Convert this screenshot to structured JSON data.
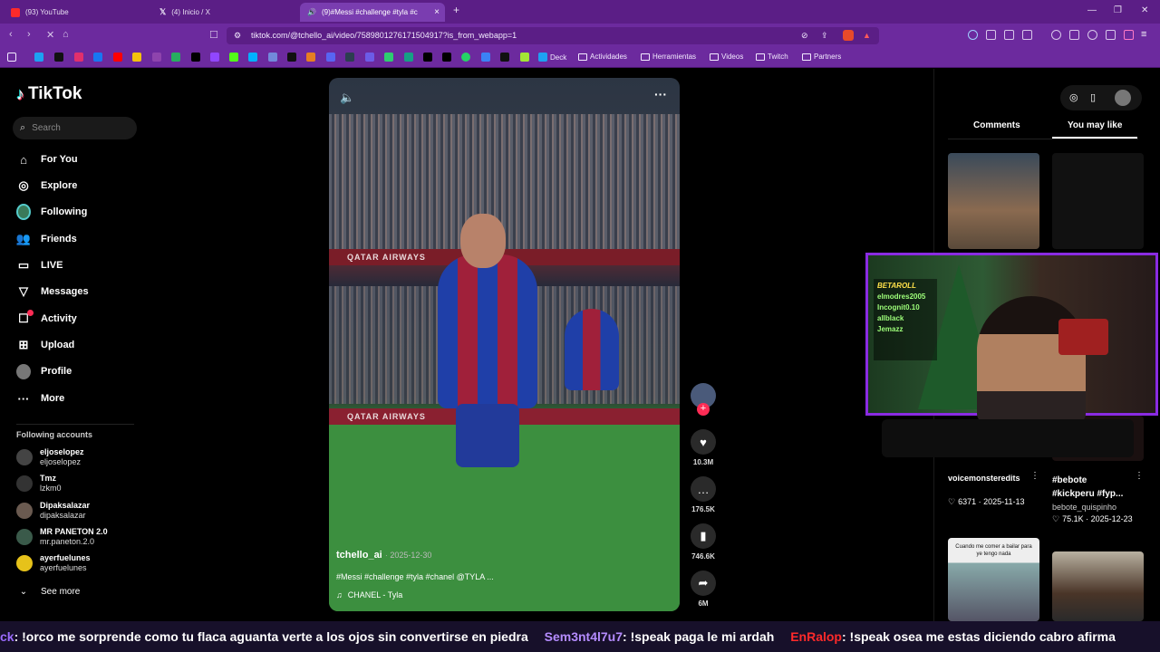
{
  "browser": {
    "tabs": [
      {
        "label": "(93) YouTube",
        "color": "#ff2a2a"
      },
      {
        "label": "(4) Inicio / X",
        "color": "#000000"
      },
      {
        "label": "(9)#Messi #challenge #tyla #c",
        "color": "#ffffff"
      }
    ],
    "url": "tiktok.com/@tchello_ai/video/7589801276171504917?is_from_webapp=1",
    "bookmarks": [
      "Deck",
      "Actividades",
      "Herramientas",
      "Videos",
      "Twitch",
      "Partners"
    ]
  },
  "tiktok": {
    "logo": "TikTok",
    "search_placeholder": "Search",
    "nav": [
      {
        "label": "For You",
        "icon": "home-icon"
      },
      {
        "label": "Explore",
        "icon": "compass-icon"
      },
      {
        "label": "Following",
        "icon": "following-avatar-icon"
      },
      {
        "label": "Friends",
        "icon": "friends-icon"
      },
      {
        "label": "LIVE",
        "icon": "live-icon"
      },
      {
        "label": "Messages",
        "icon": "messages-icon"
      },
      {
        "label": "Activity",
        "icon": "activity-icon"
      },
      {
        "label": "Upload",
        "icon": "upload-icon"
      },
      {
        "label": "Profile",
        "icon": "profile-avatar-icon"
      },
      {
        "label": "More",
        "icon": "more-icon"
      }
    ],
    "following_title": "Following accounts",
    "following": [
      {
        "name": "eljoselopez",
        "handle": "eljoselopez"
      },
      {
        "name": "Tmz",
        "handle": "lzkm0"
      },
      {
        "name": "Dipaksalazar",
        "handle": "dipaksalazar"
      },
      {
        "name": "MR PANETON 2.0",
        "handle": "mr.paneton.2.0"
      },
      {
        "name": "ayerfuelunes",
        "handle": "ayerfuelunes"
      }
    ],
    "see_more": "See more"
  },
  "video": {
    "banner_text": "QATAR AIRWAYS",
    "author": "tchello_ai",
    "date": "2025-12-30",
    "caption": "#Messi #challenge #tyla #chanel @TYLA ...",
    "music": "CHANEL - Tyla",
    "likes": "10.3M",
    "comments": "176.5K",
    "saves": "746.6K",
    "shares": "6M"
  },
  "sidepanel": {
    "tab_comments": "Comments",
    "tab_you_may_like": "You may like",
    "cards": [
      {
        "title": "voicemonsteredits",
        "stats": "6371 · 2025-11-13"
      },
      {
        "title": "#bebote #kickperu #fyp...",
        "author": "bebote_quispinho",
        "stats": "75.1K · 2025-12-23"
      }
    ],
    "thumb_text": "Cuando me comer a bailar para ye tengo nada"
  },
  "webcam_overlay": {
    "names": [
      "BETAROLL",
      "elmodres2005",
      "Incognit0.10",
      "allblack",
      "Jemazz"
    ]
  },
  "chat_ticker": [
    {
      "user": "ck",
      "text": ": !orco me sorprende como tu flaca aguanta verte a los ojos sin convertirse en piedra",
      "color": "#9b6bff"
    },
    {
      "user": "Sem3nt4l7u7",
      "text": ": !speak paga le mi ardah",
      "color": "#b58cff"
    },
    {
      "user": "EnRalop",
      "text": ": !speak osea me estas diciendo cabro afirma",
      "color": "#ff2a2a"
    }
  ]
}
